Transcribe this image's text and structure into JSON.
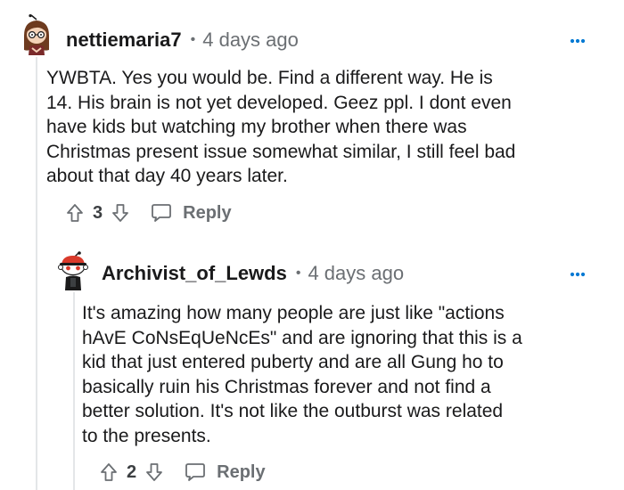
{
  "colors": {
    "text_primary": "#1a1a1b",
    "text_meta": "#6b6f73",
    "thread_line": "#e4e6e8",
    "icon": "#6b6f73"
  },
  "comments": [
    {
      "username": "nettiemaria7",
      "separator": "•",
      "timestamp": "4 days ago",
      "body": "YWBTA. Yes you would be. Find a different way. He is\n14. His brain is not yet developed. Geez ppl. I dont even\nhave kids but watching my brother when there was\nChristmas present issue somewhat similar, I still feel bad\nabout that day 40 years later.",
      "vote_count": "3",
      "reply_label": "Reply",
      "avatar_icon": "avatar-girl-glasses-icon"
    },
    {
      "username": "Archivist_of_Lewds",
      "separator": "•",
      "timestamp": "4 days ago",
      "body": "It's amazing how many people are just like \"actions\nhAvE CoNsEqUeNcEs\" and are ignoring that this is a\nkid that just entered puberty and are all Gung ho to\nbasically ruin his Christmas forever and not find a\nbetter solution. It's not like the outburst was related\nto the presents.",
      "vote_count": "2",
      "reply_label": "Reply",
      "avatar_icon": "avatar-snoo-red-cap-icon"
    }
  ],
  "icons": {
    "more": "more-options-icon",
    "upvote": "upvote-arrow-icon",
    "downvote": "downvote-arrow-icon",
    "reply": "speech-bubble-icon"
  }
}
